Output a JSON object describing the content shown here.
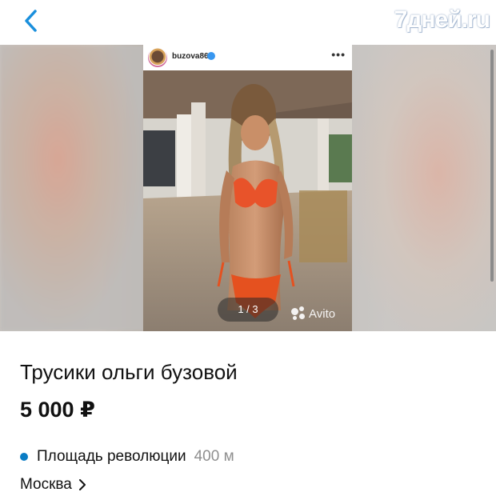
{
  "nav": {
    "back_icon": "chevron-left-icon",
    "accent_color": "#1a8fdc"
  },
  "watermark": {
    "text": "7дней.ru"
  },
  "gallery": {
    "post_username": "buzova86",
    "more_icon": "more-dots-icon",
    "more_label": "•••",
    "counter": "1 / 3",
    "avito_label": "Avito"
  },
  "listing": {
    "title": "Трусики ольги бузовой",
    "price": "5 000 ₽",
    "metro_station": "Площадь революции",
    "metro_distance": "400 м",
    "metro_color": "#0a7cc4",
    "city": "Москва"
  }
}
